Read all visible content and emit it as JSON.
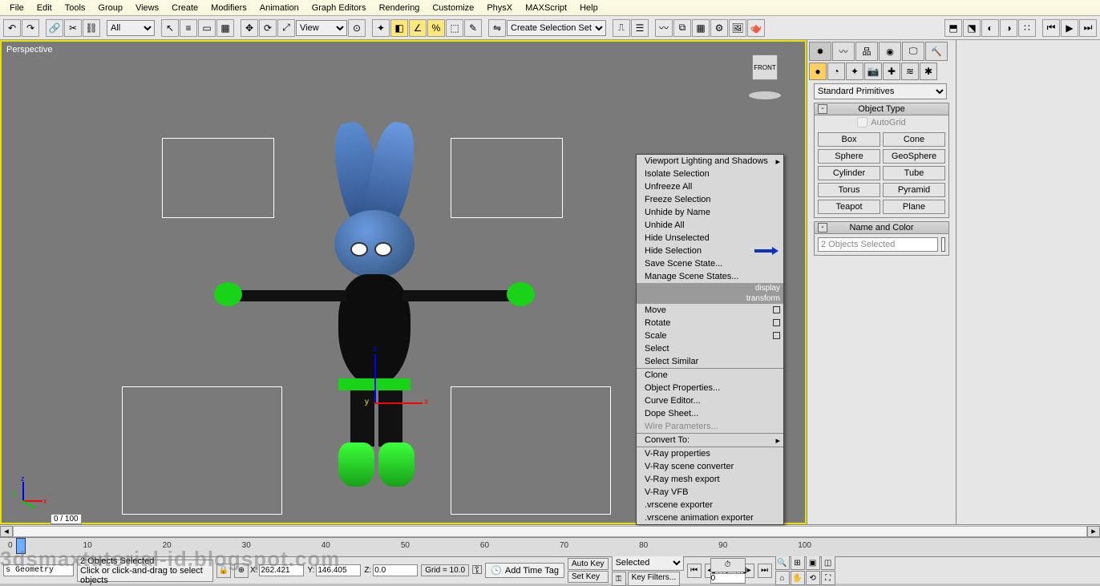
{
  "menu": [
    "File",
    "Edit",
    "Tools",
    "Group",
    "Views",
    "Create",
    "Modifiers",
    "Animation",
    "Graph Editors",
    "Rendering",
    "Customize",
    "PhysX",
    "MAXScript",
    "Help"
  ],
  "toolbar": {
    "all": "All",
    "view": "View",
    "selset": "Create Selection Set"
  },
  "viewport": {
    "label": "Perspective",
    "cube_face": "FRONT"
  },
  "axis": {
    "x": "x",
    "y": "y",
    "z": "z"
  },
  "contextMenu": {
    "items1": [
      "Viewport Lighting and Shadows",
      "Isolate Selection",
      "Unfreeze All",
      "Freeze Selection",
      "Unhide by Name",
      "Unhide All",
      "Hide Unselected",
      "Hide Selection",
      "Save Scene State...",
      "Manage Scene States..."
    ],
    "section_display": "display",
    "section_transform": "transform",
    "items2": [
      "Move",
      "Rotate",
      "Scale",
      "Select",
      "Select Similar",
      "Clone",
      "Object Properties...",
      "Curve Editor...",
      "Dope Sheet...",
      "Wire Parameters...",
      "Convert To:",
      "V-Ray properties",
      "V-Ray scene converter",
      "V-Ray mesh export",
      "V-Ray VFB",
      ".vrscene exporter",
      ".vrscene animation exporter"
    ]
  },
  "cmd": {
    "dropdown": "Standard Primitives",
    "objtype_title": "Object Type",
    "autogrid": "AutoGrid",
    "buttons": [
      "Box",
      "Cone",
      "Sphere",
      "GeoSphere",
      "Cylinder",
      "Tube",
      "Torus",
      "Pyramid",
      "Teapot",
      "Plane"
    ],
    "namecolor_title": "Name and Color",
    "name_value": "2 Objects Selected"
  },
  "timeline": {
    "frame": "0 / 100",
    "ticks": [
      "0",
      "10",
      "20",
      "30",
      "40",
      "50",
      "60",
      "70",
      "80",
      "90",
      "100"
    ]
  },
  "status": {
    "geom": "s Geometry",
    "sel": "2 Objects Selected",
    "hint": "Click or click-and-drag to select objects",
    "x": "262.421",
    "y": "146.405",
    "z": "0.0",
    "grid": "Grid = 10.0",
    "timetag": "Add Time Tag",
    "autokey": "Auto Key",
    "setkey": "Set Key",
    "selected": "Selected",
    "keyfilters": "Key Filters...",
    "spin": "0"
  },
  "watermark": "3dsmaxtutorial-id.blogspot.com"
}
